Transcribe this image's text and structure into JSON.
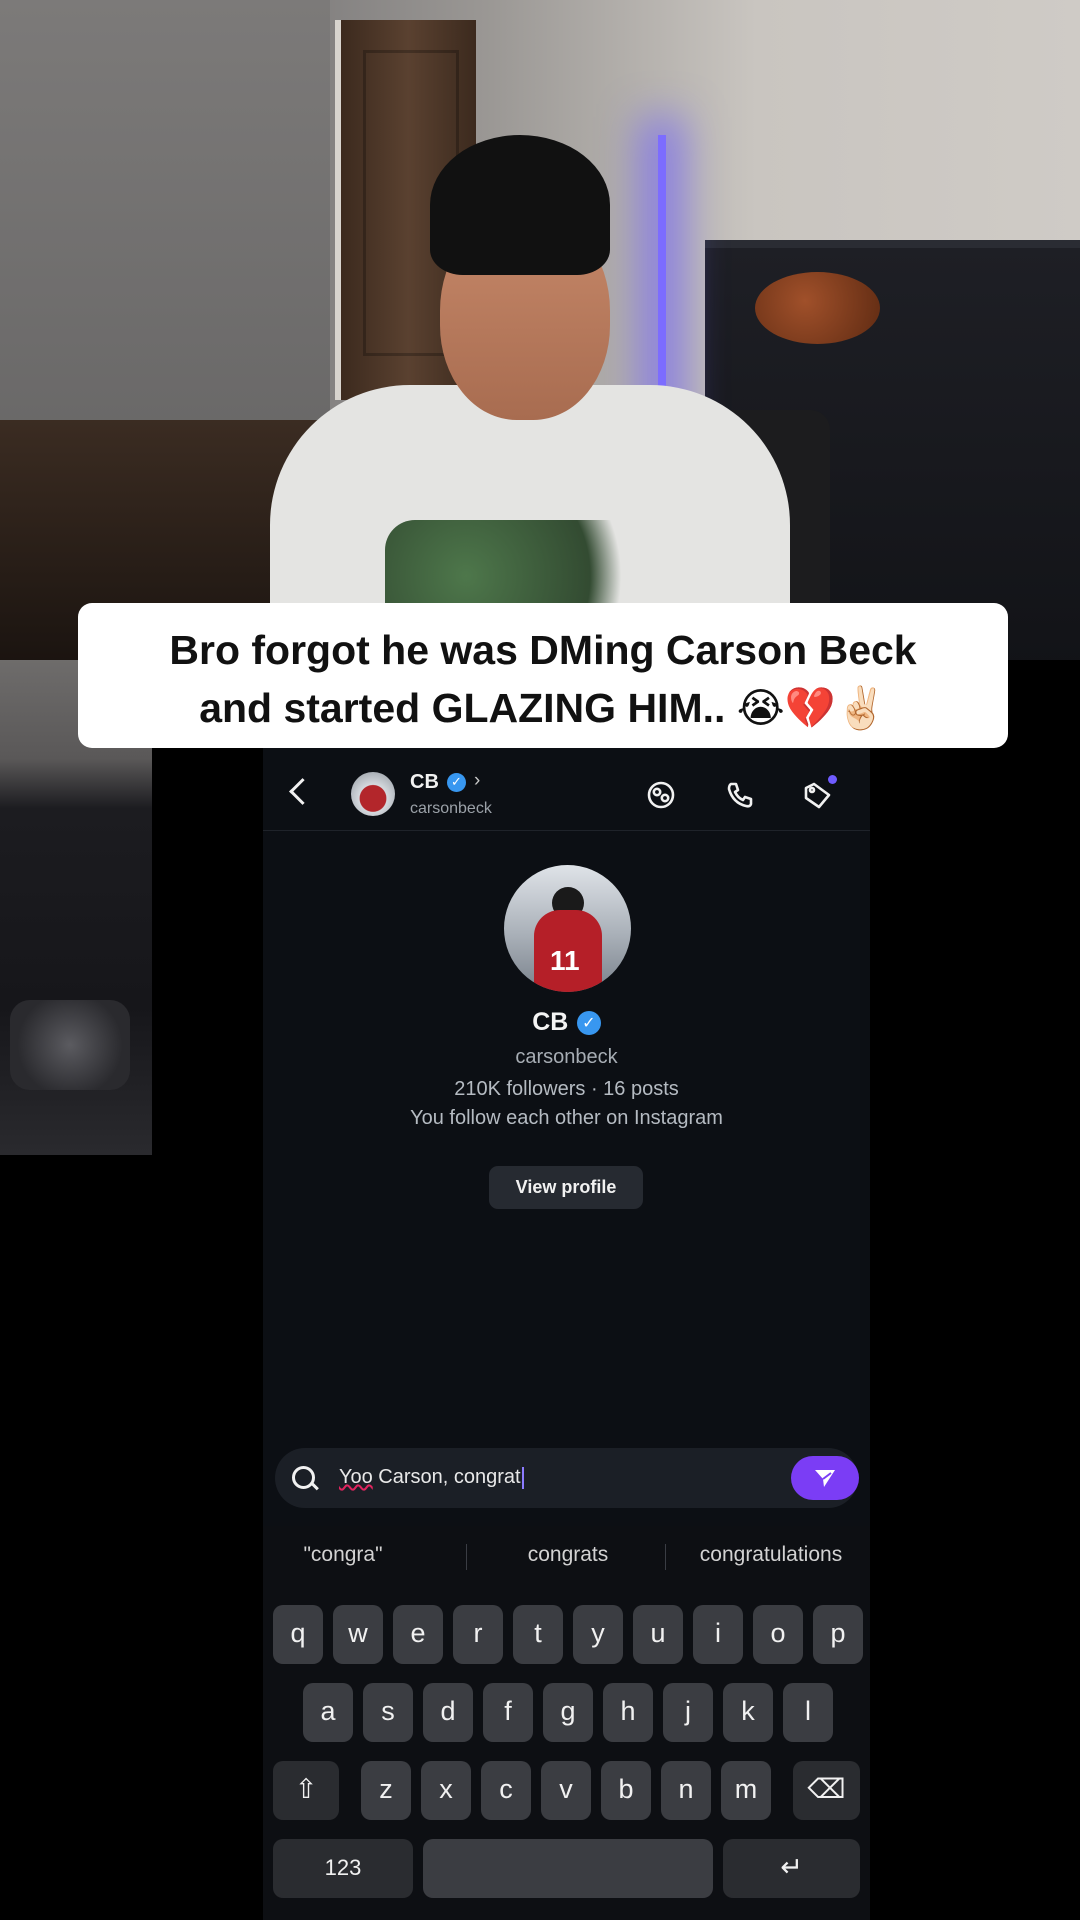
{
  "caption": {
    "line1": "Bro forgot he was DMing Carson Beck",
    "line2": "and started GLAZING HIM..",
    "emojis": "😭💔✌🏻"
  },
  "dm_header": {
    "name": "CB",
    "handle": "carsonbeck",
    "verified_glyph": "✓",
    "chevron": "›",
    "icons": [
      "back-icon",
      "sticker-icon",
      "phone-call-icon",
      "tag-icon"
    ]
  },
  "profile": {
    "name": "CB",
    "handle": "carsonbeck",
    "stats": "210K followers · 16 posts",
    "mutual": "You follow each other on Instagram",
    "view_profile_label": "View profile",
    "jersey_number": "11"
  },
  "composer": {
    "text_underlined": "Yoo",
    "text_rest": " Carson, congrat",
    "send_icon": "send-icon"
  },
  "keyboard": {
    "suggestions": [
      "\"congra\"",
      "congrats",
      "congratulations"
    ],
    "row1": [
      "q",
      "w",
      "e",
      "r",
      "t",
      "y",
      "u",
      "i",
      "o",
      "p"
    ],
    "row2": [
      "a",
      "s",
      "d",
      "f",
      "g",
      "h",
      "j",
      "k",
      "l"
    ],
    "row3": [
      "z",
      "x",
      "c",
      "v",
      "b",
      "n",
      "m"
    ],
    "shift_glyph": "⇧",
    "backspace_glyph": "⌫",
    "numbers_label": "123",
    "return_glyph": "↵"
  },
  "colors": {
    "accent_purple": "#7b3df5",
    "verified_blue": "#3897f0",
    "screen_bg": "#0c0f14"
  }
}
